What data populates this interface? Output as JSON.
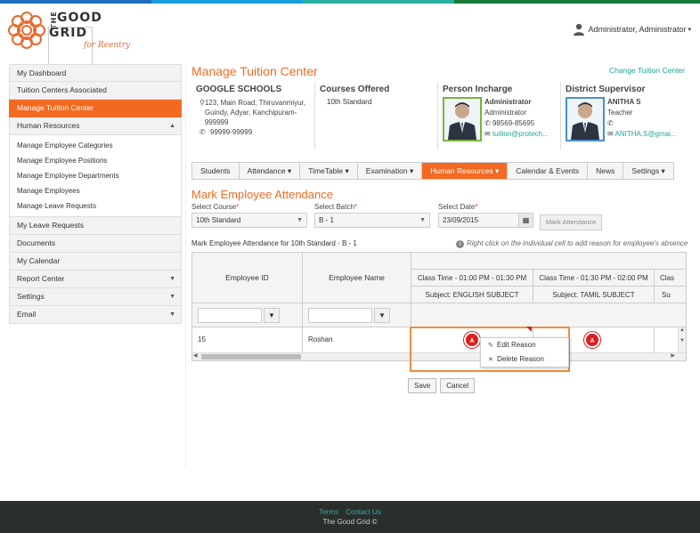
{
  "brand": {
    "line1": "THE",
    "line2": "GOOD",
    "line3": "GRID",
    "tagline": "for Reentry"
  },
  "user": {
    "name": "Administrator, Administrator"
  },
  "sidebar": {
    "items": [
      {
        "label": "My Dashboard"
      },
      {
        "label": "Tuition Centers Associated"
      },
      {
        "label": "Manage Tuition Center"
      },
      {
        "label": "Human Resources"
      }
    ],
    "hr_sub": [
      "Manage Employee Categories",
      "Manage Employee Positions",
      "Manage Employee Departments",
      "Manage Employees",
      "Manage Leave Requests"
    ],
    "bottom": [
      {
        "label": "My Leave Requests"
      },
      {
        "label": "Documents"
      },
      {
        "label": "My Calendar"
      },
      {
        "label": "Report Center"
      },
      {
        "label": "Settings"
      },
      {
        "label": "Email"
      }
    ]
  },
  "page": {
    "title": "Manage Tuition Center",
    "change_link": "Change Tuition Center"
  },
  "center": {
    "name": "GOOGLE SCHOOLS",
    "address": "123, Main Road, Thiruvanmiyur, Guindy, Adyar, Kanchipuram-999999",
    "phone": "99999-99999",
    "courses_heading": "Courses Offered",
    "course": "10th Standard",
    "incharge_heading": "Person Incharge",
    "incharge_name": "Administrator",
    "incharge_role": "Administrator",
    "incharge_phone": "98569-85695",
    "incharge_email": "tuition@protech...",
    "supervisor_heading": "District Supervisor",
    "supervisor_name": "ANITHA S",
    "supervisor_role": "Teacher",
    "supervisor_email": "ANITHA.S@gmai..."
  },
  "tabs": [
    {
      "label": "Students",
      "caret": ""
    },
    {
      "label": "Attendance",
      "caret": "▾"
    },
    {
      "label": "TimeTable",
      "caret": "▾"
    },
    {
      "label": "Examination",
      "caret": "▾"
    },
    {
      "label": "Human Resources",
      "caret": "▾"
    },
    {
      "label": "Calendar & Events",
      "caret": ""
    },
    {
      "label": "News",
      "caret": ""
    },
    {
      "label": "Settings",
      "caret": "▾"
    }
  ],
  "attendance": {
    "title": "Mark Employee Attendance",
    "course_label": "Select Course",
    "course_value": "10th Standard",
    "batch_label": "Select Batch",
    "batch_value": "B - 1",
    "date_label": "Select Date",
    "date_value": "23/09/2015",
    "mark_button": "Mark Attendance",
    "for_text": "Mark Employee Attendance for  10th Standard - B - 1",
    "hint": "Right click on the individual cell to add reason for employee's absence"
  },
  "grid": {
    "col_emp_id": "Employee ID",
    "col_emp_name": "Employee Name",
    "slot1_time": "Class Time - 01:00 PM - 01:30 PM",
    "slot1_subject": "Subject:  ENGLISH SUBJECT",
    "slot2_time": "Class Time - 01:30 PM - 02:00 PM",
    "slot2_subject": "Subject:  TAMIL SUBJECT",
    "slot3_time": "Clas",
    "slot3_subject": "Su",
    "row_id": "15",
    "row_name": "Roshan",
    "badge1": "A",
    "badge2": "A"
  },
  "context_menu": {
    "edit": "Edit Reason",
    "delete": "Delete Reason"
  },
  "buttons": {
    "save": "Save",
    "cancel": "Cancel"
  },
  "footer": {
    "terms": "Terms",
    "contact": "Contact Us",
    "copy": "The Good Grid ©"
  }
}
